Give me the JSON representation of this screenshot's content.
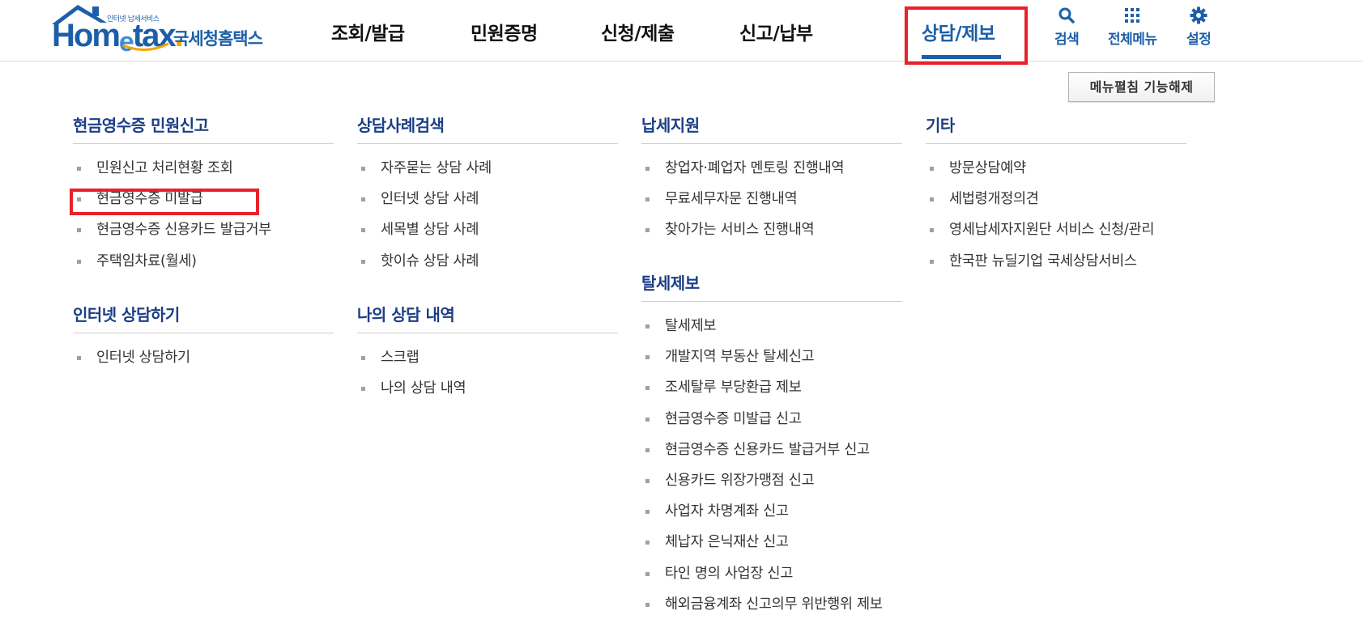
{
  "logo": {
    "small_text": "인터넷 납세서비스",
    "word_hom": "Hom",
    "word_e": "e",
    "word_tax": "tax",
    "word_dot": ".",
    "korean": "국세청홈택스"
  },
  "nav": {
    "items": [
      {
        "label": "조회/발급"
      },
      {
        "label": "민원증명"
      },
      {
        "label": "신청/제출"
      },
      {
        "label": "신고/납부"
      },
      {
        "label": "상담/제보",
        "active": true
      }
    ]
  },
  "utils": {
    "search": {
      "label": "검색",
      "icon": "search-icon"
    },
    "menu": {
      "label": "전체메뉴",
      "icon": "grid-icon"
    },
    "settings": {
      "label": "설정",
      "icon": "gear-icon"
    }
  },
  "fold_button": "메뉴펼침 기능해제",
  "colors": {
    "brand": "#1c5fa8",
    "section_title": "#1b3e86",
    "highlight": "#e8212a"
  },
  "columns": [
    {
      "sections": [
        {
          "title": "현금영수증 민원신고",
          "items": [
            "민원신고 처리현황 조회",
            "현금영수증 미발급",
            "현금영수증 신용카드 발급거부",
            "주택임차료(월세)"
          ]
        },
        {
          "title": "인터넷 상담하기",
          "items": [
            "인터넷 상담하기"
          ]
        }
      ]
    },
    {
      "sections": [
        {
          "title": "상담사례검색",
          "items": [
            "자주묻는 상담 사례",
            "인터넷 상담 사례",
            "세목별 상담 사례",
            "핫이슈 상담 사례"
          ]
        },
        {
          "title": "나의 상담 내역",
          "items": [
            "스크랩",
            "나의 상담 내역"
          ]
        }
      ]
    },
    {
      "sections": [
        {
          "title": "납세지원",
          "items": [
            "창업자·폐업자 멘토링 진행내역",
            "무료세무자문 진행내역",
            "찾아가는 서비스 진행내역"
          ]
        },
        {
          "title": "탈세제보",
          "items": [
            "탈세제보",
            "개발지역 부동산 탈세신고",
            "조세탈루 부당환급 제보",
            "현금영수증 미발급 신고",
            "현금영수증 신용카드 발급거부 신고",
            "신용카드 위장가맹점 신고",
            "사업자 차명계좌 신고",
            "체납자 은닉재산 신고",
            "타인 명의 사업장 신고",
            "해외금융계좌 신고의무 위반행위 제보"
          ]
        }
      ]
    },
    {
      "sections": [
        {
          "title": "기타",
          "items": [
            "방문상담예약",
            "세법령개정의견",
            "영세납세자지원단 서비스 신청/관리",
            "한국판 뉴딜기업 국세상담서비스"
          ]
        }
      ]
    }
  ]
}
